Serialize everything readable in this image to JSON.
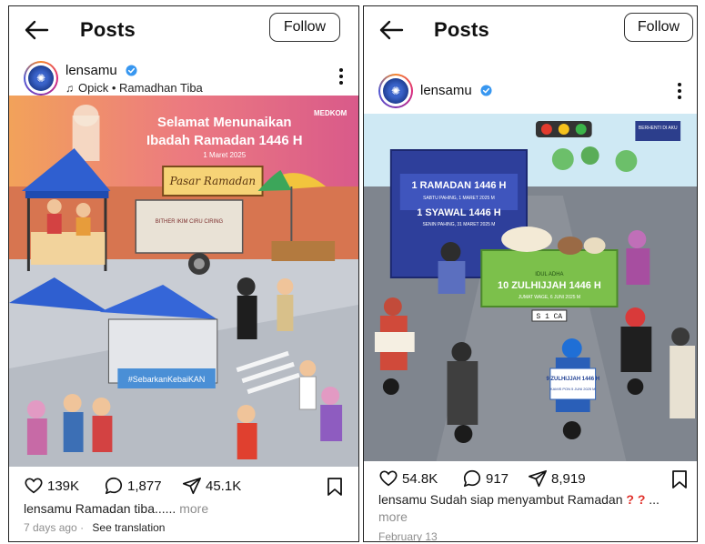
{
  "posts": [
    {
      "header_title": "Posts",
      "follow_label": "Follow",
      "username": "lensamu",
      "music": "Opick • Ramadhan Tiba",
      "image_text": {
        "greeting_line1": "Selamat Menunaikan",
        "greeting_line2": "Ibadah Ramadan 1446 H",
        "date": "1 Maret 2025",
        "brand": "MEDKOM",
        "market_sign": "Pasar Ramadan",
        "cart_sign": "BITHER IKIM CIRU CIRING",
        "campaign": "#SebarkanKebaiKAN"
      },
      "likes": "139K",
      "comments": "1,877",
      "shares": "45.1K",
      "caption_user": "lensamu",
      "caption_text": " Ramadan tiba......",
      "more": " more",
      "timestamp": "7 days ago",
      "see_translation": "See translation"
    },
    {
      "header_title": "Posts",
      "follow_label": "Follow",
      "username": "lensamu",
      "image_text": {
        "truck_line1": "1 RAMADAN 1446 H",
        "truck_line2": "SABTU PAHING, 1 MARET 2025 M",
        "truck_line3": "1 SYAWAL 1446 H",
        "truck_line4": "SENIN PAHING, 31 MARET 2025 M",
        "pickup_line1": "IDUL ADHA",
        "pickup_line2": "10 ZULHIJJAH 1446 H",
        "pickup_line3": "JUMAT WAGE, 6 JUNI 2025 M",
        "sign_right": "BERHENTI DI AKU",
        "sign_bike": "9 ZULHIJJAH 1446 H",
        "sign_bike_sub": "KAMIS PON 5 JUNI 2025 M",
        "plate": "S 1 CA"
      },
      "likes": "54.8K",
      "comments": "917",
      "shares": "8,919",
      "caption_user": "lensamu",
      "caption_text": " Sudah siap menyambut Ramadan",
      "caption_marks": "? ?",
      "caption_ellipsis": " ...",
      "more": "more",
      "timestamp": "February 13"
    }
  ],
  "colors": {
    "verified": "#3897f0",
    "muted": "#8e8e8e"
  },
  "icons": [
    "back-arrow-icon",
    "verified-icon",
    "music-note-icon",
    "more-options-icon",
    "heart-icon",
    "comment-icon",
    "share-icon",
    "bookmark-icon"
  ]
}
